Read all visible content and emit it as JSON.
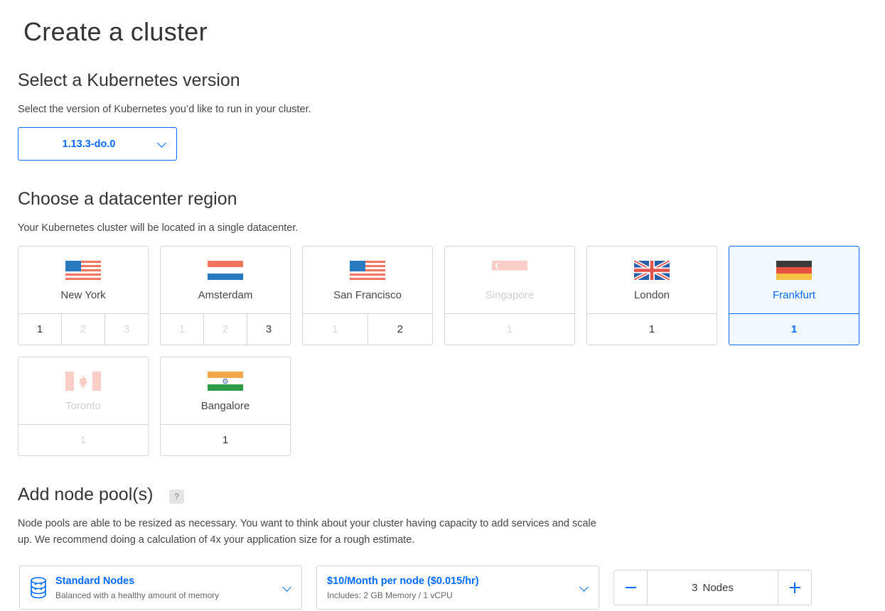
{
  "page": {
    "title": "Create a cluster"
  },
  "version_section": {
    "title": "Select a Kubernetes version",
    "description": "Select the version of Kubernetes you’d like to run in your cluster.",
    "selected_version": "1.13.3-do.0"
  },
  "region_section": {
    "title": "Choose a datacenter region",
    "description": "Your Kubernetes cluster will be located in a single datacenter.",
    "regions": [
      {
        "name": "New York",
        "flag": "us-flag",
        "datacenters": [
          {
            "label": "1",
            "available": true
          },
          {
            "label": "2",
            "available": false
          },
          {
            "label": "3",
            "available": false
          }
        ],
        "state": "available"
      },
      {
        "name": "Amsterdam",
        "flag": "nl-flag",
        "datacenters": [
          {
            "label": "1",
            "available": false
          },
          {
            "label": "2",
            "available": false
          },
          {
            "label": "3",
            "available": true
          }
        ],
        "state": "available"
      },
      {
        "name": "San Francisco",
        "flag": "us-flag",
        "datacenters": [
          {
            "label": "1",
            "available": false
          },
          {
            "label": "2",
            "available": true
          }
        ],
        "state": "available"
      },
      {
        "name": "Singapore",
        "flag": "sg-flag",
        "datacenters": [
          {
            "label": "1",
            "available": false
          }
        ],
        "state": "disabled"
      },
      {
        "name": "London",
        "flag": "uk-flag",
        "datacenters": [
          {
            "label": "1",
            "available": true
          }
        ],
        "state": "available"
      },
      {
        "name": "Frankfurt",
        "flag": "de-flag",
        "datacenters": [
          {
            "label": "1",
            "available": true
          }
        ],
        "state": "selected"
      },
      {
        "name": "Toronto",
        "flag": "ca-flag",
        "datacenters": [
          {
            "label": "1",
            "available": false
          }
        ],
        "state": "disabled"
      },
      {
        "name": "Bangalore",
        "flag": "in-flag",
        "datacenters": [
          {
            "label": "1",
            "available": true
          }
        ],
        "state": "available"
      }
    ]
  },
  "node_pool_section": {
    "title": "Add node pool(s)",
    "help_label": "?",
    "description_line1": "Node pools are able to be resized as necessary. You want to think about your cluster having capacity to add services and scale",
    "description_line2": "up. We recommend doing a calculation of 4x your application size for a rough estimate.",
    "node_type": {
      "title": "Standard Nodes",
      "subtitle": "Balanced with a healthy amount of memory",
      "icon": "database-stack-icon"
    },
    "node_plan": {
      "title": "$10/Month per node ($0.015/hr)",
      "subtitle": "Includes: 2 GB Memory / 1 vCPU"
    },
    "node_count": {
      "value": "3",
      "unit": "Nodes"
    }
  },
  "colors": {
    "accent": "#0069ff",
    "border": "#d4d4d4",
    "selected_bg": "#f2f8ff",
    "disabled_text": "#d0d0d0"
  }
}
